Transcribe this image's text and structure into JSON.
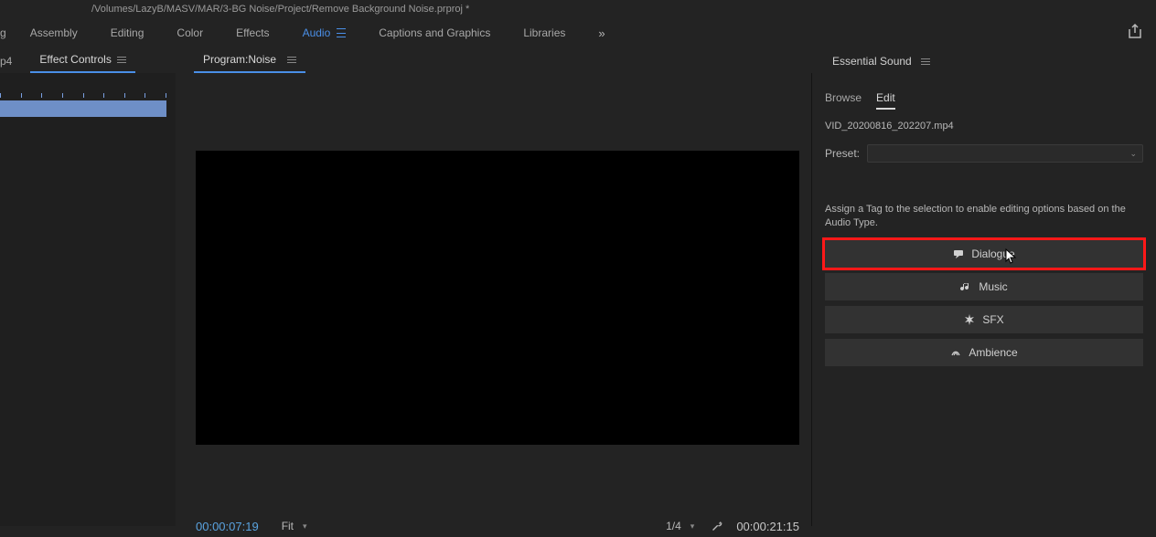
{
  "title_bar": {
    "path": "/Volumes/LazyB/MASV/MAR/3-BG Noise/Project/Remove Background Noise.prproj *"
  },
  "workspace_tabs": {
    "cut": "g",
    "items": [
      "Assembly",
      "Editing",
      "Color",
      "Effects",
      "Audio",
      "Captions and Graphics",
      "Libraries"
    ],
    "active_index": 4,
    "overflow": "»"
  },
  "left_panels": {
    "source_cut": "p4",
    "effect_controls": "Effect Controls"
  },
  "program": {
    "title_prefix": "Program: ",
    "title_name": "Noise",
    "timecode_left": "00:00:07:19",
    "fit_label": "Fit",
    "zoom_label": "1/4",
    "timecode_right": "00:00:21:15"
  },
  "essential_sound": {
    "title": "Essential Sound",
    "tabs": [
      "Browse",
      "Edit"
    ],
    "active_tab": 1,
    "clip": "VID_20200816_202207.mp4",
    "preset_label": "Preset:",
    "assign_text": "Assign a Tag to the selection to enable editing options based on the Audio Type.",
    "tags": [
      {
        "icon": "dialogue",
        "label": "Dialogue",
        "highlighted": true
      },
      {
        "icon": "music",
        "label": "Music",
        "highlighted": false
      },
      {
        "icon": "sfx",
        "label": "SFX",
        "highlighted": false
      },
      {
        "icon": "ambience",
        "label": "Ambience",
        "highlighted": false
      }
    ]
  }
}
